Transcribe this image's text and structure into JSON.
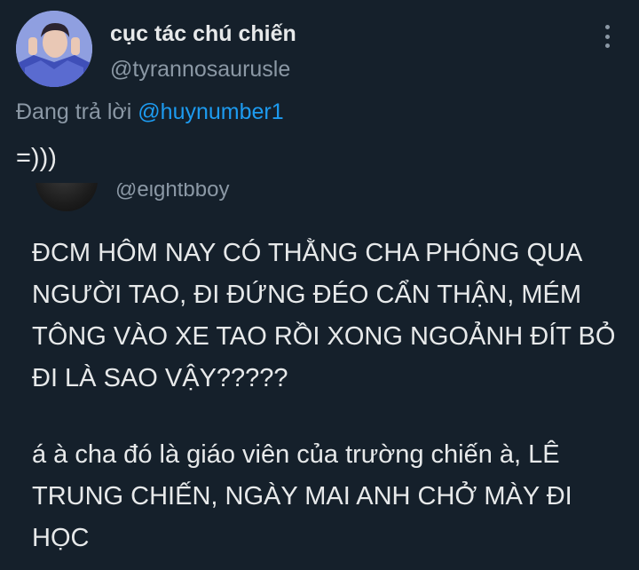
{
  "author": {
    "display_name": "cục tác chú chiến",
    "handle": "@tyrannosaurusle"
  },
  "reply": {
    "prefix": "Đang trả lời",
    "mention": "@huynumber1"
  },
  "tweet": {
    "text": "=)))"
  },
  "quoted_tweet": {
    "handle": "@eightbboy",
    "paragraphs": [
      "ĐCM HÔM NAY CÓ THẰNG CHA PHÓNG QUA NGƯỜI TAO, ĐI ĐỨNG ĐÉO CẨN THẬN, MÉM TÔNG VÀO XE TAO RỒI XONG NGOẢNH ĐÍT BỎ ĐI LÀ SAO VẬY?????",
      "á à cha đó là giáo viên của trường chiến à, LÊ TRUNG CHIẾN, NGÀY MAI ANH CHỞ MÀY ĐI HỌC"
    ]
  },
  "icons": {
    "more": "more-vertical-icon"
  },
  "colors": {
    "background": "#15202b",
    "text": "#e7e9ea",
    "muted": "#8b98a5",
    "link": "#1d9bf0"
  }
}
